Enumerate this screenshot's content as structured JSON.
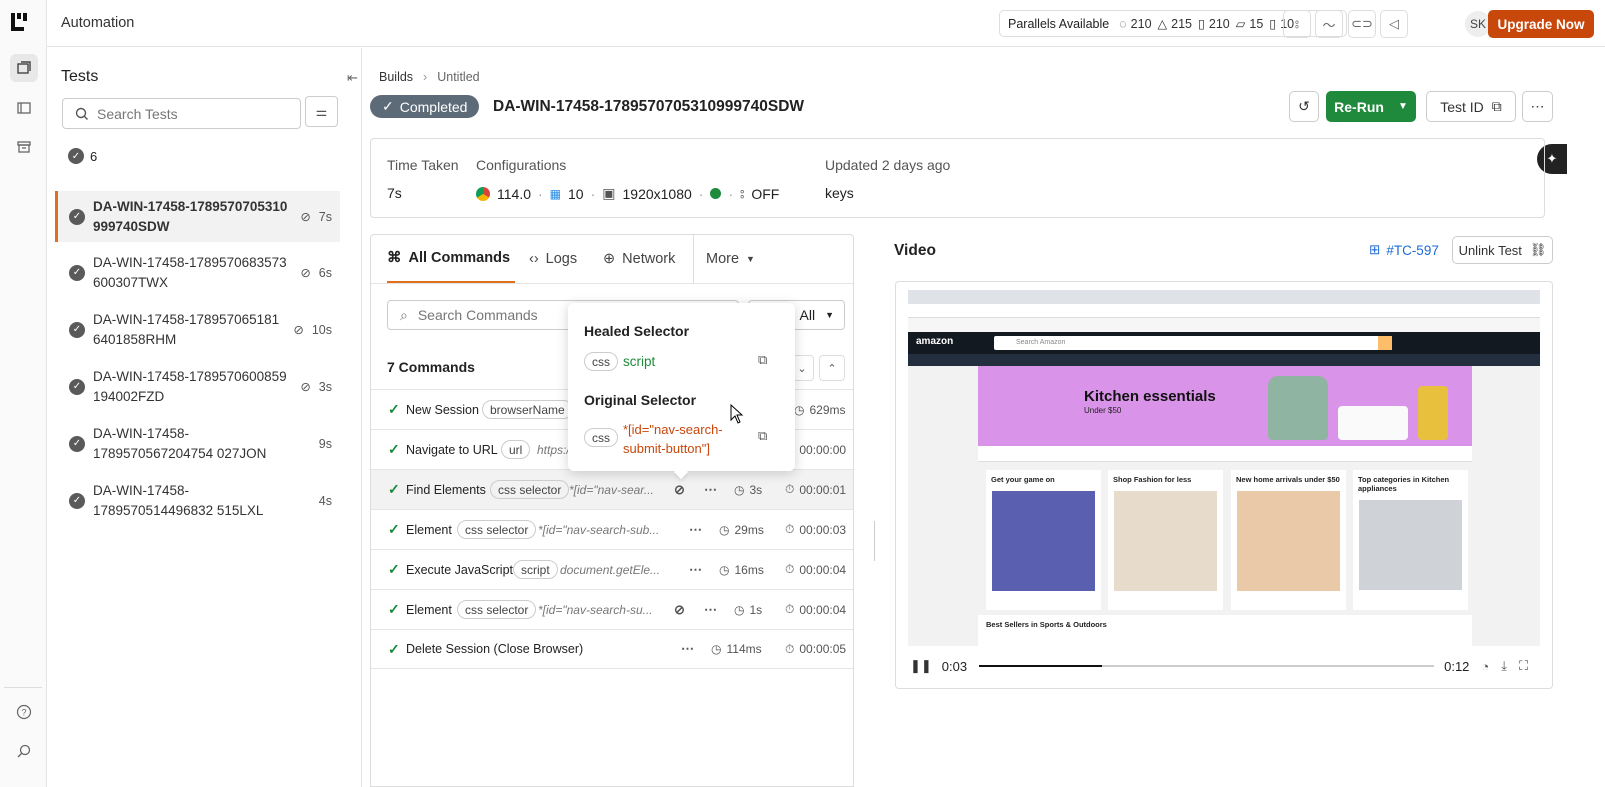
{
  "app": {
    "title": "Automation"
  },
  "header": {
    "parallels_label": "Parallels Available",
    "stats": [
      "210",
      "215",
      "210",
      "15",
      "10"
    ],
    "avatar": "SK",
    "upgrade": "Upgrade Now"
  },
  "sidebar": {
    "title": "Tests",
    "search_placeholder": "Search Tests",
    "count": "6",
    "tests": [
      {
        "name": "DA-WIN-17458-1789570705310 999740SDW",
        "duration": "7s"
      },
      {
        "name": "DA-WIN-17458-1789570683573 600307TWX",
        "duration": "6s"
      },
      {
        "name": "DA-WIN-17458-178957065181 6401858RHM",
        "duration": "10s"
      },
      {
        "name": "DA-WIN-17458-1789570600859 194002FZD",
        "duration": "3s"
      },
      {
        "name": "DA-WIN-17458-1789570567204754 027JON",
        "duration": "9s"
      },
      {
        "name": "DA-WIN-17458-1789570514496832 515LXL",
        "duration": "4s"
      }
    ]
  },
  "breadcrumb": {
    "root": "Builds",
    "current": "Untitled"
  },
  "test": {
    "status": "Completed",
    "id": "DA-WIN-17458-1789570705310999740SDW",
    "rerun": "Re-Run",
    "test_id_btn": "Test ID"
  },
  "info": {
    "time_label": "Time Taken",
    "time_value": "7s",
    "config_label": "Configurations",
    "browser_ver": "114.0",
    "os_ver": "10",
    "resolution": "1920x1080",
    "tunnel": "OFF",
    "updated": "Updated 2 days ago",
    "keys": "keys"
  },
  "tabs": {
    "all": "All Commands",
    "logs": "Logs",
    "network": "Network",
    "more": "More"
  },
  "commands": {
    "search_placeholder": "Search Commands",
    "filter": "All",
    "count_label": "7 Commands",
    "rows": [
      {
        "name": "New Session",
        "pill": "browserName",
        "arg": "",
        "dur": "629ms",
        "ts": ""
      },
      {
        "name": "Navigate to URL",
        "pill": "url",
        "arg": "https:/",
        "dur": "",
        "ts": "00:00:00"
      },
      {
        "name": "Find Elements",
        "pill": "css selector",
        "arg": "*[id=\"nav-sear...",
        "dur": "3s",
        "ts": "00:00:01"
      },
      {
        "name": "Element",
        "pill": "css selector",
        "arg": "*[id=\"nav-search-sub...",
        "dur": "29ms",
        "ts": "00:00:03"
      },
      {
        "name": "Execute JavaScript",
        "pill": "script",
        "arg": "document.getEle...",
        "dur": "16ms",
        "ts": "00:00:04"
      },
      {
        "name": "Element",
        "pill": "css selector",
        "arg": "*[id=\"nav-search-su...",
        "dur": "1s",
        "ts": "00:00:04"
      },
      {
        "name": "Delete Session (Close Browser)",
        "pill": "",
        "arg": "",
        "dur": "114ms",
        "ts": "00:00:05"
      }
    ]
  },
  "popup": {
    "healed_title": "Healed Selector",
    "healed_type": "css",
    "healed_value": "script",
    "orig_title": "Original Selector",
    "orig_type": "css",
    "orig_value": "*[id=\"nav-search-submit-button\"]"
  },
  "video": {
    "title": "Video",
    "ticket": "#TC-597",
    "unlink": "Unlink Test",
    "current_time": "0:03",
    "total_time": "0:12",
    "progress": 0.27
  },
  "screen": {
    "banner_title": "Kitchen essentials",
    "banner_sub": "Under $50",
    "search_placeholder": "Search Amazon",
    "cards": [
      "Get your game on",
      "Shop Fashion for less",
      "New home arrivals under $50",
      "Top categories in Kitchen appliances"
    ],
    "bottom": "Best Sellers in Sports & Outdoors",
    "logo": "amazon"
  },
  "colors": {
    "accent": "#c8470b",
    "success": "#1f8a3c",
    "status": "#5d6b78",
    "selected_border": "#e0701e"
  }
}
